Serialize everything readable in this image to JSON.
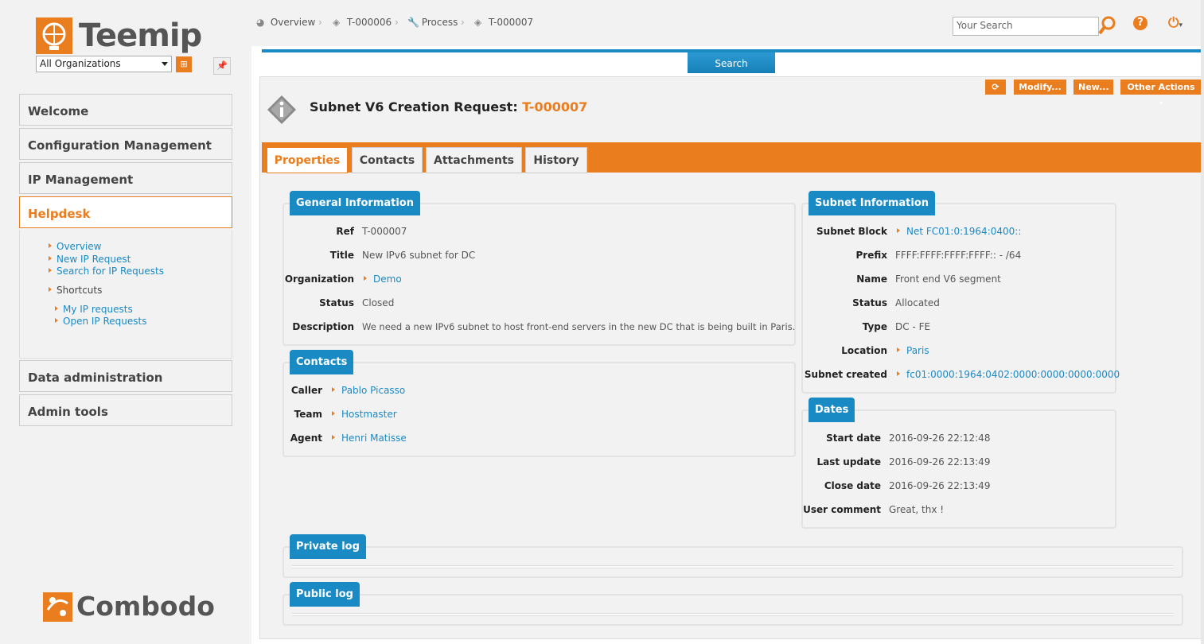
{
  "brand": {
    "name": "Teemip",
    "footer": "Combodo"
  },
  "org_select": {
    "value": "All Organizations"
  },
  "menu": {
    "welcome": "Welcome",
    "config": "Configuration Management",
    "ip": "IP Management",
    "helpdesk": "Helpdesk",
    "data_admin": "Data administration",
    "admin_tools": "Admin tools"
  },
  "helpdesk_sub": {
    "overview": "Overview",
    "new_request": "New IP Request",
    "search_requests": "Search for IP Requests",
    "shortcuts": "Shortcuts",
    "my_requests": "My IP requests",
    "open_requests": "Open IP Requests"
  },
  "breadcrumb": [
    {
      "label": "Overview"
    },
    {
      "label": "T-000006"
    },
    {
      "label": "Process"
    },
    {
      "label": "T-000007"
    }
  ],
  "search": {
    "placeholder": "Your Search",
    "tab_label": "Search"
  },
  "actions": {
    "modify": "Modify...",
    "new": "New...",
    "other": "Other Actions"
  },
  "header": {
    "title": "Subnet V6 Creation Request:",
    "ref": "T-000007"
  },
  "tabs": [
    "Properties",
    "Contacts",
    "Attachments",
    "History"
  ],
  "general": {
    "legend": "General Information",
    "ref_label": "Ref",
    "ref_value": "T-000007",
    "title_label": "Title",
    "title_value": "New IPv6 subnet for DC",
    "org_label": "Organization",
    "org_value": "Demo",
    "status_label": "Status",
    "status_value": "Closed",
    "desc_label": "Description",
    "desc_value": "We need a new IPv6 subnet to host front-end servers in the new DC that is being built in Paris."
  },
  "contacts": {
    "legend": "Contacts",
    "caller_label": "Caller",
    "caller_value": "Pablo Picasso",
    "team_label": "Team",
    "team_value": "Hostmaster",
    "agent_label": "Agent",
    "agent_value": "Henri Matisse"
  },
  "subnet": {
    "legend": "Subnet Information",
    "block_label": "Subnet Block",
    "block_value": "Net FC01:0:1964:0400::",
    "prefix_label": "Prefix",
    "prefix_value": "FFFF:FFFF:FFFF:FFFF:: - /64",
    "name_label": "Name",
    "name_value": "Front end V6 segment",
    "status_label": "Status",
    "status_value": "Allocated",
    "type_label": "Type",
    "type_value": "DC - FE",
    "location_label": "Location",
    "location_value": "Paris",
    "created_label": "Subnet created",
    "created_value": "fc01:0000:1964:0402:0000:0000:0000:0000"
  },
  "dates": {
    "legend": "Dates",
    "start_label": "Start date",
    "start_value": "2016-09-26 22:12:48",
    "update_label": "Last update",
    "update_value": "2016-09-26 22:13:49",
    "close_label": "Close date",
    "close_value": "2016-09-26 22:13:49",
    "comment_label": "User comment",
    "comment_value": "Great, thx !"
  },
  "logs": {
    "private": "Private log",
    "public": "Public log"
  },
  "colors": {
    "accent": "#ea7d1e",
    "link": "#1a8ac4"
  }
}
